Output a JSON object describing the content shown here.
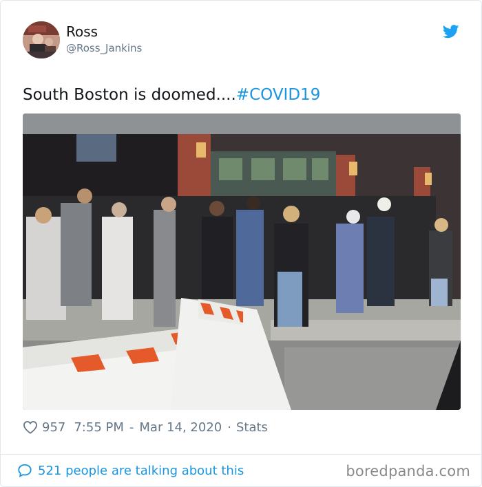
{
  "tweet": {
    "author": {
      "display_name": "Ross",
      "handle": "@Ross_Jankins"
    },
    "text": "South Boston is doomed....",
    "hashtag": "#COVID19",
    "likes": "957",
    "time": "7:55 PM",
    "date_separator": "-",
    "date": "Mar 14, 2020",
    "meta_separator": "·",
    "stats_label": "Stats",
    "conversation_label": "521 people are talking about this"
  },
  "watermark": "boredpanda.com",
  "icons": {
    "brand": "twitter-bird-icon",
    "like": "heart-icon",
    "conversation": "speech-bubble-icon"
  },
  "colors": {
    "link_blue": "#1b95e0",
    "muted_gray": "#657786",
    "twitter_blue": "#1da1f2"
  }
}
